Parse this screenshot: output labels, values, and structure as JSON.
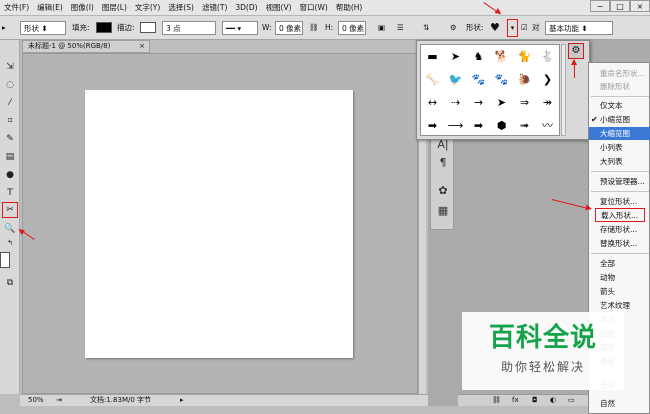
{
  "menubar": {
    "items": [
      "文件(F)",
      "编辑(E)",
      "图像(I)",
      "图层(L)",
      "文字(Y)",
      "选择(S)",
      "滤镜(T)",
      "3D(D)",
      "视图(V)",
      "窗口(W)",
      "帮助(H)"
    ],
    "minimize": "−",
    "restore": "□",
    "close": "×"
  },
  "options": {
    "mode": "形状",
    "fill_label": "填充:",
    "stroke_label": "描边:",
    "stroke_size": "3 点",
    "w_label": "W:",
    "w_value": "0 像素",
    "h_label": "H:",
    "h_value": "0 像素",
    "shape_label": "形状:",
    "align_label": "对",
    "workspace": "基本功能"
  },
  "document": {
    "tab_title": "未标题-1 @ 50%(RGB/8)",
    "zoom": "50%",
    "doc_info": "文档:1.83M/0 字节"
  },
  "shapes": [
    "▬",
    "➤",
    "♞",
    "🐕",
    "🐈",
    "🐇",
    "🦴",
    "🐦",
    "🐾",
    "🐾",
    "🐌",
    "❯",
    "↔",
    "⇢",
    "→",
    "➤",
    "⇒",
    "↠",
    "➡",
    "⟶",
    "➡",
    "⬢",
    "➟",
    "〰"
  ],
  "context_menu": {
    "items": [
      {
        "label": "重命名形状...",
        "state": "disabled"
      },
      {
        "label": "删除形状",
        "state": "disabled"
      },
      {
        "label": "仅文本",
        "state": "normal"
      },
      {
        "label": "小缩览图",
        "state": "checked"
      },
      {
        "label": "大缩览图",
        "state": "highlighted"
      },
      {
        "label": "小列表",
        "state": "normal"
      },
      {
        "label": "大列表",
        "state": "normal"
      },
      {
        "label": "预设管理器...",
        "state": "normal"
      },
      {
        "label": "复位形状...",
        "state": "normal"
      },
      {
        "label": "载入形状...",
        "state": "boxed"
      },
      {
        "label": "存储形状...",
        "state": "normal"
      },
      {
        "label": "替换形状...",
        "state": "normal"
      },
      {
        "label": "全部",
        "state": "normal"
      },
      {
        "label": "动物",
        "state": "normal"
      },
      {
        "label": "箭头",
        "state": "normal"
      },
      {
        "label": "艺术纹理",
        "state": "normal"
      },
      {
        "label": "奖品",
        "state": "normal"
      },
      {
        "label": "边框",
        "state": "normal"
      },
      {
        "label": "装饰",
        "state": "normal"
      },
      {
        "label": "画包",
        "state": "normal"
      },
      {
        "label": "音乐",
        "state": "normal"
      },
      {
        "label": "自然",
        "state": "normal"
      }
    ]
  },
  "watermark": {
    "title": "百科全说",
    "subtitle": "助你轻松解决"
  },
  "colors": {
    "accent_red": "#e11919",
    "menu_highlight": "#3a7ad6",
    "watermark_green": "#15a34a"
  }
}
